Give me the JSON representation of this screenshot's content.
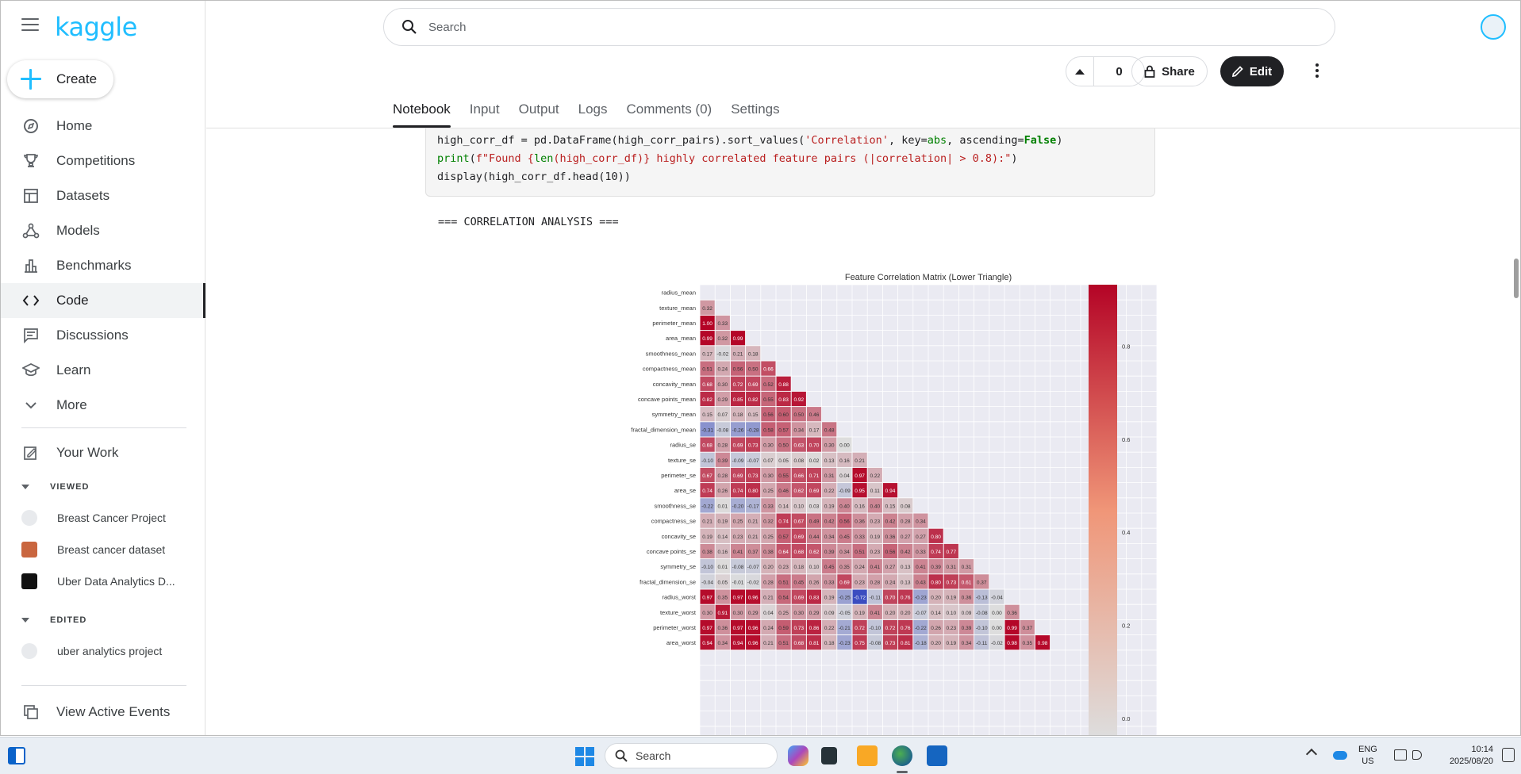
{
  "brand": {
    "name": "kaggle"
  },
  "create_label": "Create",
  "nav": [
    {
      "label": "Home",
      "icon": "compass-icon"
    },
    {
      "label": "Competitions",
      "icon": "trophy-icon"
    },
    {
      "label": "Datasets",
      "icon": "table-icon"
    },
    {
      "label": "Models",
      "icon": "models-icon"
    },
    {
      "label": "Benchmarks",
      "icon": "bar-chart-icon"
    },
    {
      "label": "Code",
      "icon": "code-icon"
    },
    {
      "label": "Discussions",
      "icon": "discussion-icon"
    },
    {
      "label": "Learn",
      "icon": "school-icon"
    },
    {
      "label": "More",
      "icon": "chevron-down-icon"
    }
  ],
  "your_work": "Your Work",
  "viewed_header": "VIEWED",
  "viewed": [
    "Breast Cancer Project",
    "Breast cancer dataset",
    "Uber Data Analytics D..."
  ],
  "edited_header": "EDITED",
  "edited": [
    "uber analytics project"
  ],
  "view_events": "View Active Events",
  "search_placeholder": "Search",
  "vote_count": "0",
  "share_label": "Share",
  "edit_label": "Edit",
  "tabs": [
    "Notebook",
    "Input",
    "Output",
    "Logs",
    "Comments (0)",
    "Settings"
  ],
  "code": {
    "line1a": "high_corr_df = pd.DataFrame(high_corr_pairs).sort_values(",
    "line1b": "'Correlation'",
    "line1c": ", key=",
    "line1d": "abs",
    "line1e": ", ascending=",
    "line1f": "False",
    "line1g": ")",
    "line2a": "print",
    "line2b": "(",
    "line2c": "f\"Found {",
    "line2d": "len",
    "line2e": "(high_corr_df)} highly correlated feature pairs (|correlation| > 0.8):\"",
    "line2f": ")",
    "line3": "display(high_corr_df.head(10))"
  },
  "output_text": "=== CORRELATION ANALYSIS ===",
  "chart_data": {
    "type": "heatmap",
    "title": "Feature Correlation Matrix (Lower Triangle)",
    "row_labels": [
      "radius_mean",
      "texture_mean",
      "perimeter_mean",
      "area_mean",
      "smoothness_mean",
      "compactness_mean",
      "concavity_mean",
      "concave points_mean",
      "symmetry_mean",
      "fractal_dimension_mean",
      "radius_se",
      "texture_se",
      "perimeter_se",
      "area_se",
      "smoothness_se",
      "compactness_se",
      "concavity_se",
      "concave points_se",
      "symmetry_se",
      "fractal_dimension_se",
      "radius_worst",
      "texture_worst",
      "perimeter_worst",
      "area_worst"
    ],
    "rows": [
      [],
      [
        0.32
      ],
      [
        1.0,
        0.33
      ],
      [
        0.99,
        0.32,
        0.99
      ],
      [
        0.17,
        -0.02,
        0.21,
        0.18
      ],
      [
        0.51,
        0.24,
        0.56,
        0.5,
        0.66
      ],
      [
        0.68,
        0.3,
        0.72,
        0.69,
        0.52,
        0.88
      ],
      [
        0.82,
        0.29,
        0.85,
        0.82,
        0.55,
        0.83,
        0.92
      ],
      [
        0.15,
        0.07,
        0.18,
        0.15,
        0.56,
        0.6,
        0.5,
        0.46
      ],
      [
        -0.31,
        -0.08,
        -0.26,
        -0.28,
        0.58,
        0.57,
        0.34,
        0.17,
        0.48
      ],
      [
        0.68,
        0.28,
        0.69,
        0.73,
        0.3,
        0.5,
        0.63,
        0.7,
        0.3,
        0.0
      ],
      [
        -0.1,
        0.39,
        -0.09,
        -0.07,
        0.07,
        0.05,
        0.08,
        0.02,
        0.13,
        0.16,
        0.21
      ],
      [
        0.67,
        0.28,
        0.69,
        0.73,
        0.3,
        0.55,
        0.66,
        0.71,
        0.31,
        0.04,
        0.97,
        0.22
      ],
      [
        0.74,
        0.26,
        0.74,
        0.8,
        0.25,
        0.46,
        0.62,
        0.69,
        0.22,
        -0.09,
        0.95,
        0.11,
        0.94
      ],
      [
        -0.22,
        0.01,
        -0.2,
        -0.17,
        0.33,
        0.14,
        0.1,
        0.03,
        0.19,
        0.4,
        0.16,
        0.4,
        0.15,
        0.08
      ],
      [
        0.21,
        0.19,
        0.25,
        0.21,
        0.32,
        0.74,
        0.67,
        0.49,
        0.42,
        0.56,
        0.36,
        0.23,
        0.42,
        0.28,
        0.34
      ],
      [
        0.19,
        0.14,
        0.23,
        0.21,
        0.25,
        0.57,
        0.69,
        0.44,
        0.34,
        0.45,
        0.33,
        0.19,
        0.36,
        0.27,
        0.27,
        0.8
      ],
      [
        0.38,
        0.16,
        0.41,
        0.37,
        0.38,
        0.64,
        0.68,
        0.62,
        0.39,
        0.34,
        0.51,
        0.23,
        0.56,
        0.42,
        0.33,
        0.74,
        0.77
      ],
      [
        -0.1,
        0.01,
        -0.08,
        -0.07,
        0.2,
        0.23,
        0.18,
        0.1,
        0.45,
        0.35,
        0.24,
        0.41,
        0.27,
        0.13,
        0.41,
        0.39,
        0.31,
        0.31
      ],
      [
        -0.04,
        0.05,
        -0.01,
        -0.02,
        0.28,
        0.51,
        0.45,
        0.26,
        0.33,
        0.69,
        0.23,
        0.28,
        0.24,
        0.13,
        0.43,
        0.8,
        0.73,
        0.61,
        0.37
      ],
      [
        0.97,
        0.35,
        0.97,
        0.96,
        0.21,
        0.54,
        0.69,
        0.83,
        0.19,
        -0.25,
        -0.72,
        -0.11,
        0.7,
        0.76,
        -0.23,
        0.2,
        0.19,
        0.36,
        -0.13,
        -0.04
      ],
      [
        0.3,
        0.91,
        0.3,
        0.29,
        0.04,
        0.25,
        0.3,
        0.29,
        0.09,
        -0.05,
        0.19,
        0.41,
        0.2,
        0.2,
        -0.07,
        0.14,
        0.1,
        0.09,
        -0.08,
        -0.0,
        0.36
      ],
      [
        0.97,
        0.36,
        0.97,
        0.96,
        0.24,
        0.59,
        0.73,
        0.86,
        0.22,
        -0.21,
        0.72,
        -0.1,
        0.72,
        0.76,
        -0.22,
        0.26,
        0.23,
        0.39,
        -0.1,
        0.0,
        0.99,
        0.37
      ],
      [
        0.94,
        0.34,
        0.94,
        0.96,
        0.21,
        0.51,
        0.68,
        0.81,
        0.18,
        -0.23,
        0.75,
        -0.08,
        0.73,
        0.81,
        -0.18,
        0.2,
        0.19,
        0.34,
        -0.11,
        -0.02,
        0.98,
        0.35,
        0.98
      ]
    ],
    "colorbar_ticks": [
      0.8,
      0.6,
      0.4,
      0.2,
      0.0
    ],
    "colormap": "coolwarm"
  },
  "taskbar": {
    "search_label": "Search",
    "lang_top": "ENG",
    "lang_bottom": "US",
    "time": "10:14",
    "date": "2025/08/20"
  }
}
